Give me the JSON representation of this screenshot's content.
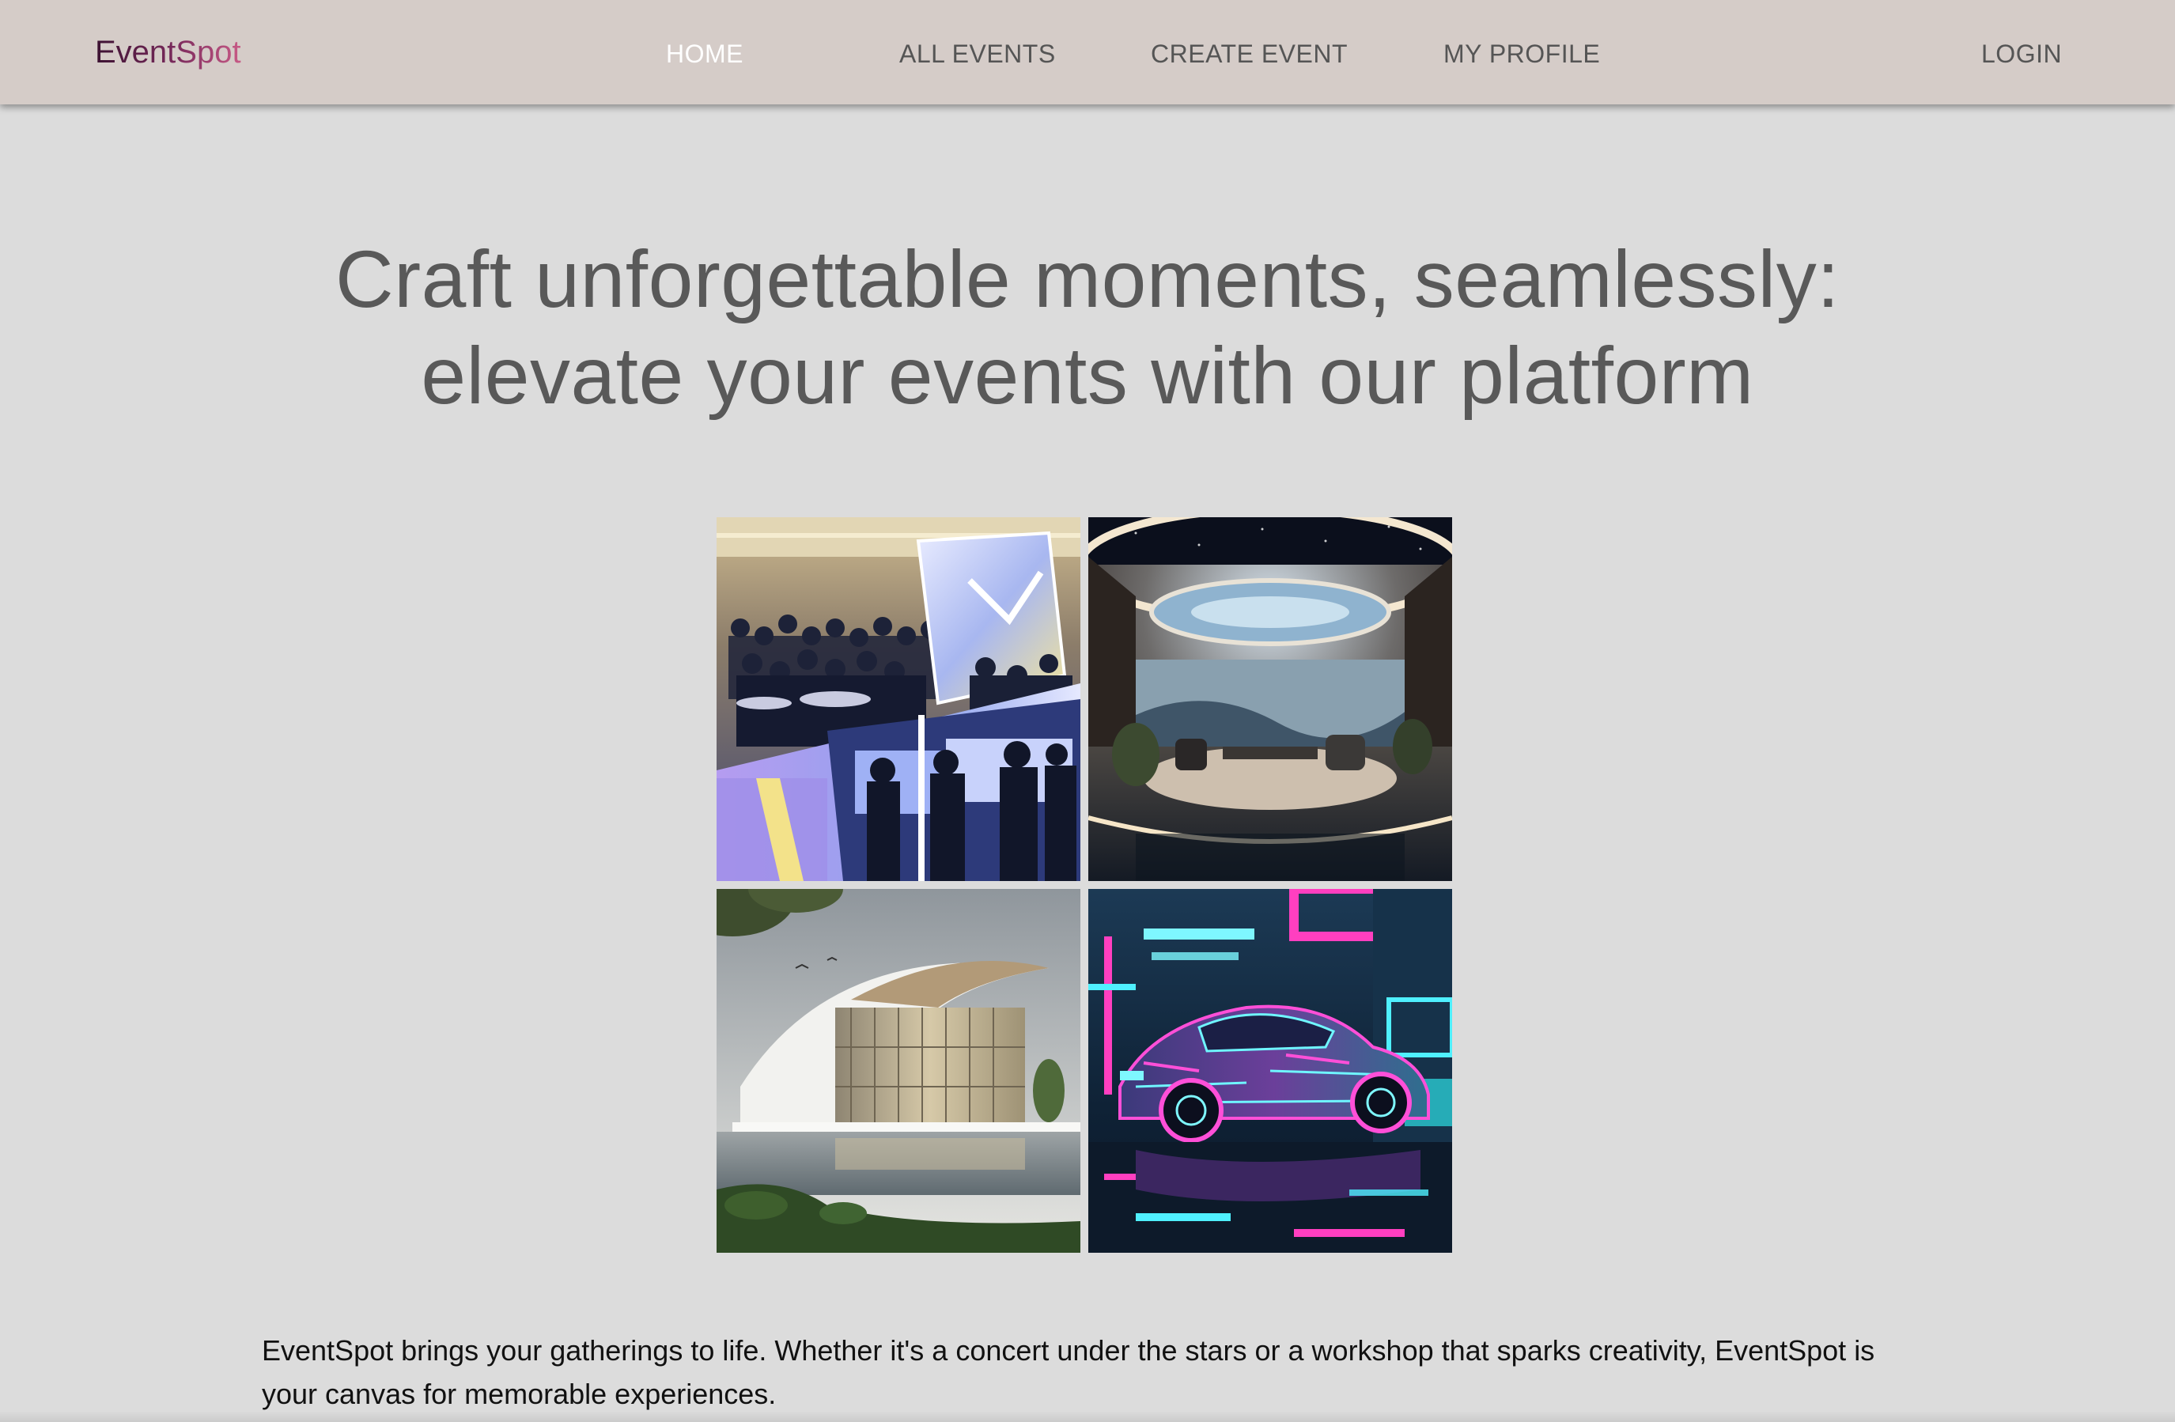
{
  "brand": {
    "name": "EventSpot"
  },
  "nav": {
    "items": [
      {
        "label": "HOME",
        "active": true
      },
      {
        "label": "ALL EVENTS",
        "active": false
      },
      {
        "label": "CREATE EVENT",
        "active": false
      },
      {
        "label": "MY PROFILE",
        "active": false
      }
    ],
    "login_label": "LOGIN"
  },
  "hero": {
    "title_line1": "Craft unforgettable moments, seamlessly:",
    "title_line2": "elevate your events with our platform"
  },
  "gallery": {
    "images": [
      {
        "icon": "conference-hall-image"
      },
      {
        "icon": "futuristic-lounge-image"
      },
      {
        "icon": "waterfront-venue-image"
      },
      {
        "icon": "neon-car-image"
      }
    ]
  },
  "intro": {
    "text": "EventSpot brings your gatherings to life. Whether it's a concert under the stars or a workshop that sparks creativity, EventSpot is your canvas for memorable experiences."
  },
  "colors": {
    "navbar_bg": "#d5ccc8",
    "page_bg": "#dcdcdc",
    "active_nav": "#ffffff",
    "nav_text": "#555555",
    "heading_text": "#595959"
  }
}
